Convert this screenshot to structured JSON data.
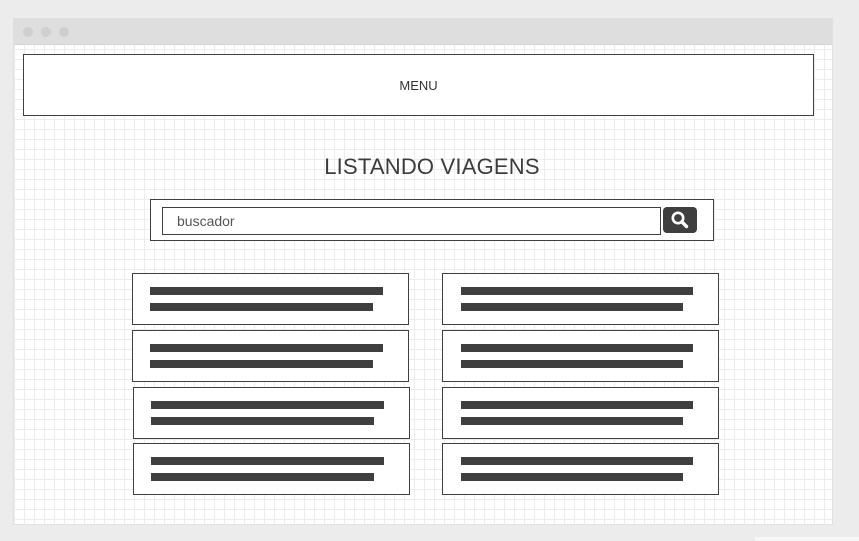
{
  "menu": {
    "label": "MENU"
  },
  "page": {
    "title": "LISTANDO VIAGENS"
  },
  "search": {
    "placeholder": "buscador",
    "button_icon": "search-icon"
  },
  "colors": {
    "window_bg": "#ffffff",
    "grid": "#ececec",
    "border": "#3f3f3f",
    "button": "#3f3f3f",
    "titlebar": "#dedede"
  },
  "list": {
    "columns": 2,
    "rows": 4,
    "item_count": 8
  }
}
